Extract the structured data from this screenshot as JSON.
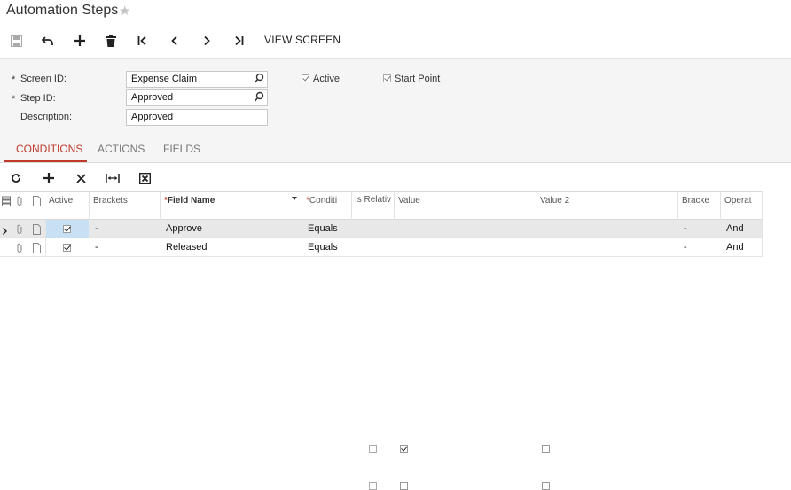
{
  "page": {
    "title": "Automation Steps"
  },
  "toolbar": {
    "view_screen_label": "VIEW SCREEN"
  },
  "form": {
    "screen_id_label": "Screen ID:",
    "screen_id_value": "Expense Claim",
    "step_id_label": "Step ID:",
    "step_id_value": "Approved",
    "description_label": "Description:",
    "description_value": "Approved",
    "active_label": "Active",
    "active_checked": true,
    "start_point_label": "Start Point",
    "start_point_checked": true,
    "required_mark": "*"
  },
  "tabs": [
    {
      "label": "CONDITIONS",
      "active": true
    },
    {
      "label": "ACTIONS",
      "active": false
    },
    {
      "label": "FIELDS",
      "active": false
    }
  ],
  "grid": {
    "columns": {
      "active": "Active",
      "brackets": "Brackets",
      "field_name": "Field Name",
      "condition": "Conditi",
      "is_relative": "Is Relativ",
      "value": "Value",
      "value2": "Value 2",
      "brackets_close": "Bracke",
      "operator": "Operat"
    },
    "rows": [
      {
        "selected": true,
        "active": true,
        "brackets": "-",
        "field_name": "Approve",
        "condition": "Equals",
        "is_relative": false,
        "value_checked": true,
        "value2_checked": false,
        "brackets_close": "-",
        "operator": "And"
      },
      {
        "selected": false,
        "active": true,
        "brackets": "-",
        "field_name": "Released",
        "condition": "Equals",
        "is_relative": false,
        "value_checked": false,
        "value2_checked": false,
        "brackets_close": "-",
        "operator": "And"
      }
    ]
  },
  "colors": {
    "accent": "#c0392b",
    "selected_cell": "#c8e0f4",
    "form_bg": "#f5f5f5"
  }
}
